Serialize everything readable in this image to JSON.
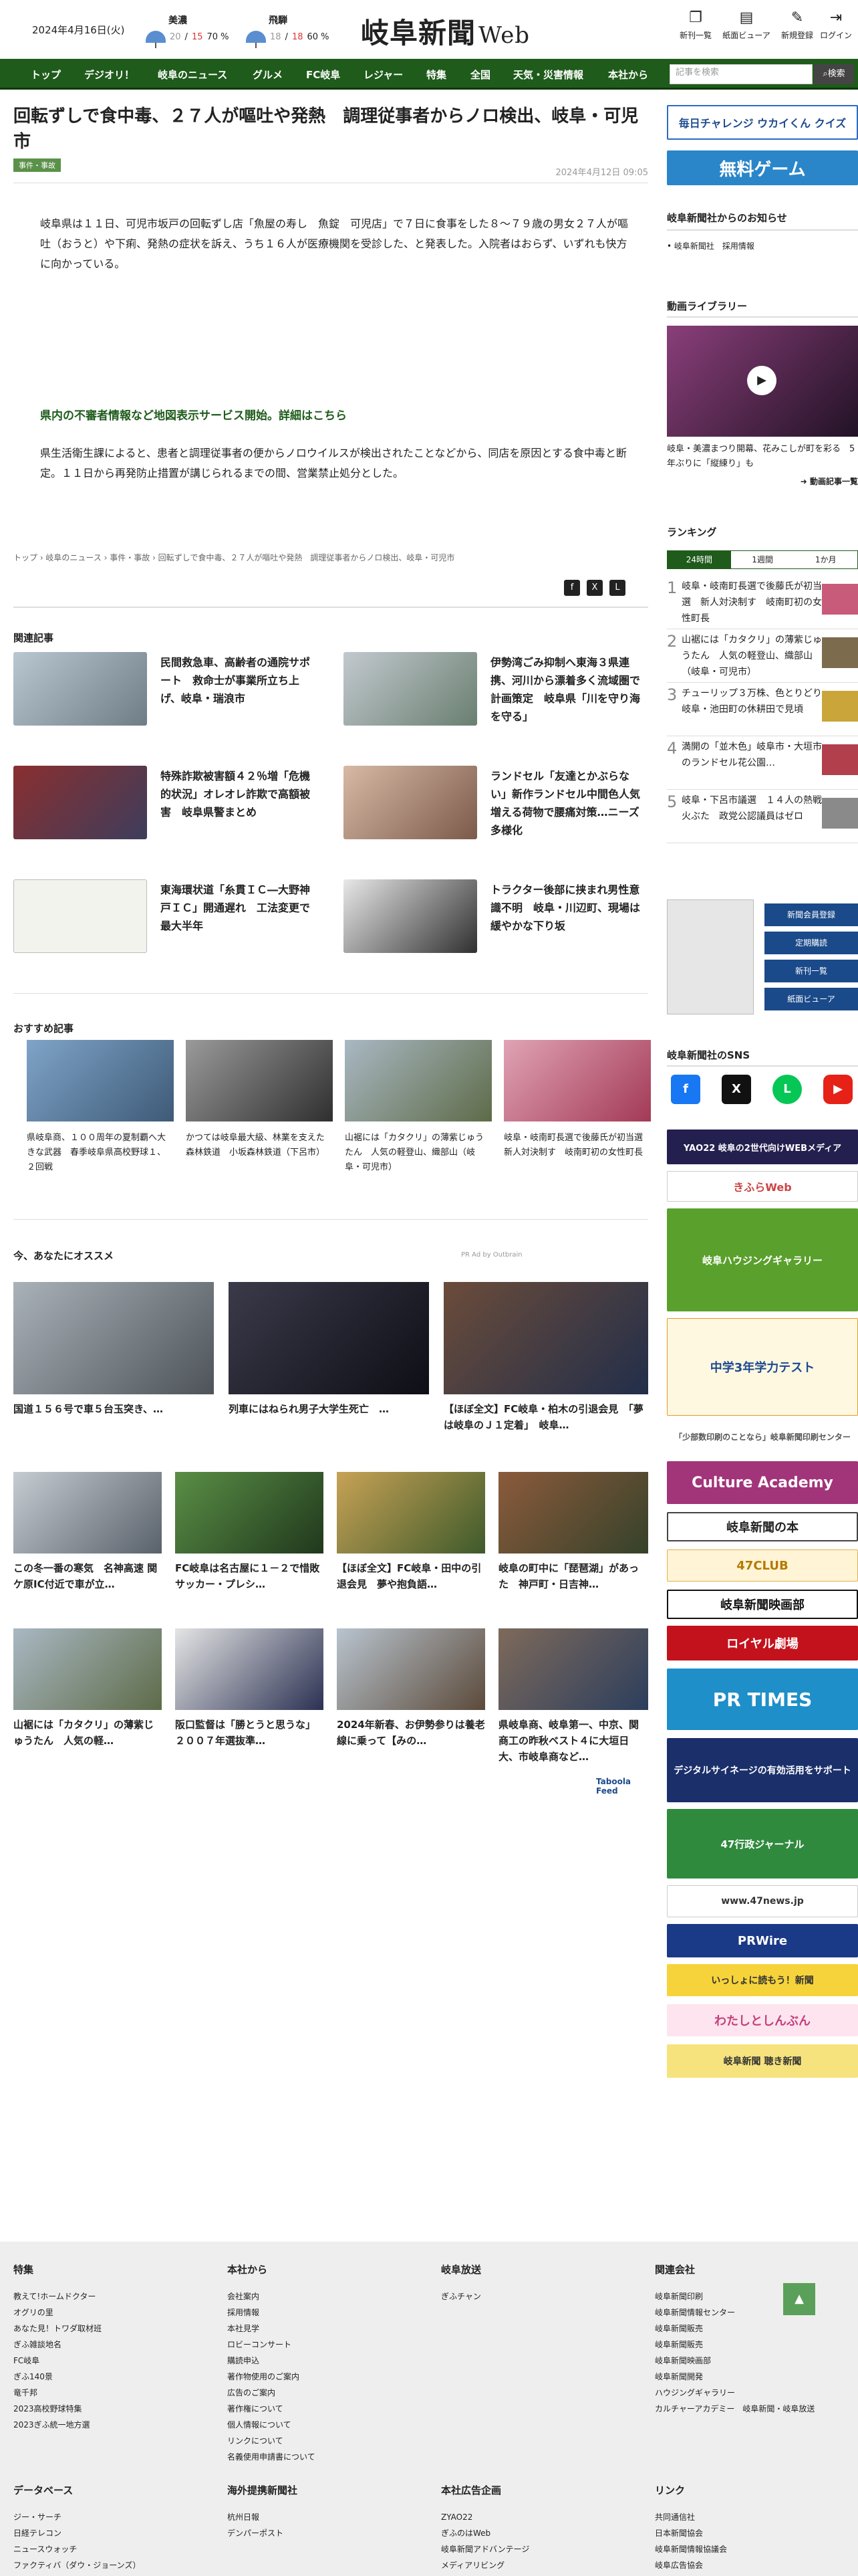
{
  "header": {
    "date": "2024年4月16日(火)",
    "weather": [
      {
        "name": "美濃",
        "low": "20",
        "sep": "/",
        "high": "15",
        "pop": "70 %"
      },
      {
        "name": "飛騨",
        "low": "18",
        "sep": "/",
        "high": "18",
        "pop": "60 %"
      }
    ],
    "logo": "岐阜新聞",
    "logo_suffix": "Web",
    "buttons": [
      "新刊一覧",
      "紙面ビューア",
      "新規登録",
      "ログイン"
    ]
  },
  "nav": {
    "items": [
      "トップ",
      "デジオリ！",
      "岐阜のニュース",
      "グルメ",
      "FC岐阜",
      "レジャー",
      "特集",
      "全国",
      "天気・災害情報",
      "本社から"
    ],
    "search_placeholder": "記事を検索",
    "search_button": "検索"
  },
  "article": {
    "title": "回転ずしで食中毒、２７人が嘔吐や発熱　調理従事者からノロ検出、岐阜・可児市",
    "tag": "事件・事故",
    "published": "2024年4月12日 09:05",
    "p1": "岐阜県は１１日、可児市坂戸の回転ずし店「魚屋の寿し　魚錠　可児店」で７日に食事をした８～７９歳の男女２７人が嘔吐（おうと）や下痢、発熱の症状を訴え、うち１６人が医療機関を受診した、と発表した。入院者はおらず、いずれも快方に向かっている。",
    "alert": "県内の不審者情報など地図表示サービス開始。詳細はこちら",
    "p2": "県生活衛生課によると、患者と調理従事者の便からノロウイルスが検出されたことなどから、同店を原因とする食中毒と断定。１１日から再発防止措置が講じられるまでの間、営業禁止処分とした。",
    "breadcrumb": "トップ › 岐阜のニュース › 事件・事故 › 回転ずしで食中毒、２７人が嘔吐や発熱　調理従事者からノロ検出、岐阜・可児市"
  },
  "related": {
    "heading": "関連記事",
    "items": [
      "民間救急車、高齢者の通院サポート　救命士が事業所立ち上げ、岐阜・瑞浪市",
      "伊勢湾ごみ抑制へ東海３県連携、河川から漂着多く流域圏で計画策定　岐阜県「川を守り海を守る」",
      "特殊詐欺被害額４２％増「危機的状況」オレオレ詐欺で高額被害　岐阜県警まとめ",
      "ランドセル「友達とかぶらない」新作ランドセル中間色人気　増える荷物で腰痛対策…ニーズ多様化",
      "東海環状道「糸貫ＩＣ―大野神戸ＩＣ」開通遅れ　工法変更で最大半年",
      "トラクター後部に挟まれ男性意識不明　岐阜・川辺町、現場は緩やかな下り坂"
    ]
  },
  "recommend": {
    "heading": "おすすめ記事",
    "items": [
      "県岐阜商、１００周年の夏制覇へ大きな武器　春季岐阜県高校野球１、２回戦",
      "かつては岐阜最大級、林業を支えた森林鉄道　小坂森林鉄道（下呂市）",
      "山裾には「カタクリ」の薄紫じゅうたん　人気の軽登山、織部山（岐阜・可児市）",
      "岐阜・岐南町長選で後藤氏が初当選　新人対決制す　岐南町初の女性町長"
    ]
  },
  "foryou": {
    "heading": "今、あなたにオススメ",
    "promo": "PR Ad by Outbrain",
    "items": [
      "国道１５６号で車５台玉突き、…",
      "列車にはねられ男子大学生死亡　…",
      "【ほぼ全文】FC岐阜・柏木の引退会見　「夢は岐阜のＪ１定着」　岐阜…",
      "この冬一番の寒気　名神高速 関ケ原IC付近で車が立…",
      "FC岐阜は名古屋に１－２で惜敗　サッカー・プレシ…",
      "【ほぼ全文】FC岐阜・田中の引退会見　夢や抱負語…",
      "岐阜の町中に「琵琶湖」があった　神戸町・日吉神…",
      "山裾には「カタクリ」の薄紫じゅうたん　人気の軽…",
      "阪口監督は「勝とうと思うな」　２００７年選抜準…",
      "2024年新春、お伊勢参りは養老線に乗って【みの…",
      "県岐阜商、岐阜第一、中京、関商工の昨秋ベスト４に大垣日大、市岐阜商など…"
    ],
    "footer": "Taboola Feed"
  },
  "sidebar": {
    "quiz": "毎日チャレンジ ウカイくん クイズ",
    "game": "無料ゲーム",
    "notice_heading": "岐阜新聞社からのお知らせ",
    "notice": "岐阜新聞社　採用情報",
    "video_heading": "動画ライブラリー",
    "video_caption": "岐阜・美濃まつり開幕、花みこしが町を彩る　5年ぶりに「縦練り」も",
    "video_more": "動画記事一覧",
    "ranking_heading": "ランキング",
    "ranking_tabs": [
      "24時間",
      "1週間",
      "1か月"
    ],
    "ranking": [
      "岐阜・岐南町長選で後藤氏が初当選　新人対決制す　岐南町初の女性町長",
      "山裾には「カタクリ」の薄紫じゅうたん　人気の軽登山、織部山（岐阜・可児市）",
      "チューリップ３万株、色とりどり　岐阜・池田町の休耕田で見頃",
      "満開の「並木色」岐阜市・大垣市のランドセル花公園…",
      "岐阜・下呂市議選　１４人の熱戦火ぶた　政党公認議員はゼロ"
    ],
    "paper_buttons": [
      "新聞会員登録",
      "定期購読",
      "新刊一覧",
      "紙面ビューア"
    ],
    "sns_heading": "岐阜新聞社のSNS",
    "banners": [
      "YAO22 岐阜の2世代向けWEBメディア",
      "きふらWeb",
      "岐阜ハウジングギャラリー",
      "中学3年学力テスト",
      "「少部数印刷のことなら」岐阜新聞印刷センター",
      "Culture Academy",
      "岐阜新聞の本",
      "47CLUB",
      "岐阜新聞映画部",
      "ロイヤル劇場",
      "PR TIMES",
      "デジタルサイネージの有効活用をサポート",
      "47行政ジャーナル",
      "www.47news.jp",
      "PRWire",
      "いっしょに読もう！新聞",
      "わたしとしんぶん",
      "岐阜新聞 聴き新聞"
    ]
  },
  "footer": {
    "columns": [
      {
        "h": "特集",
        "items": [
          "教えて!ホームドクター",
          "オグリの里",
          "あなた見！トワダ取材班",
          "ぎふ雑談地名",
          "FC岐阜",
          "ぎふ140景",
          "竜千邦",
          "2023高校野球特集",
          "2023ぎふ統一地方選"
        ]
      },
      {
        "h": "本社から",
        "items": [
          "会社案内",
          "採用情報",
          "本社見学",
          "ロビーコンサート",
          "購読申込",
          "著作物使用のご案内",
          "広告のご案内",
          "著作権について",
          "個人情報について",
          "リンクについて",
          "名義使用申請書について"
        ]
      },
      {
        "h": "岐阜放送",
        "items": [
          "ぎふチャン"
        ]
      },
      {
        "h": "関連会社",
        "items": [
          "岐阜新聞印刷",
          "岐阜新聞情報センター",
          "岐阜新聞販売",
          "岐阜新聞販売",
          "岐阜新聞映画部",
          "岐阜新聞開発",
          "ハウジングギャラリー",
          "カルチャーアカデミー　岐阜新聞・岐阜放送"
        ]
      },
      {
        "h": "データベース",
        "items": [
          "ジー・サーチ",
          "日経テレコン",
          "ニュースウォッチ",
          "ファクティバ（ダウ・ジョーンズ）"
        ]
      },
      {
        "h": "海外提携新聞社",
        "items": [
          "杭州日報",
          "デンパーポスト"
        ]
      },
      {
        "h": "本社広告企画",
        "items": [
          "ZYAO22",
          "ぎふのはWeb",
          "岐阜新聞アドバンテージ",
          "メディアリビング"
        ]
      },
      {
        "h": "リンク",
        "items": [
          "共同通信社",
          "日本新聞協会",
          "岐阜新聞情報協議会",
          "岐阜広告協会"
        ]
      }
    ]
  }
}
